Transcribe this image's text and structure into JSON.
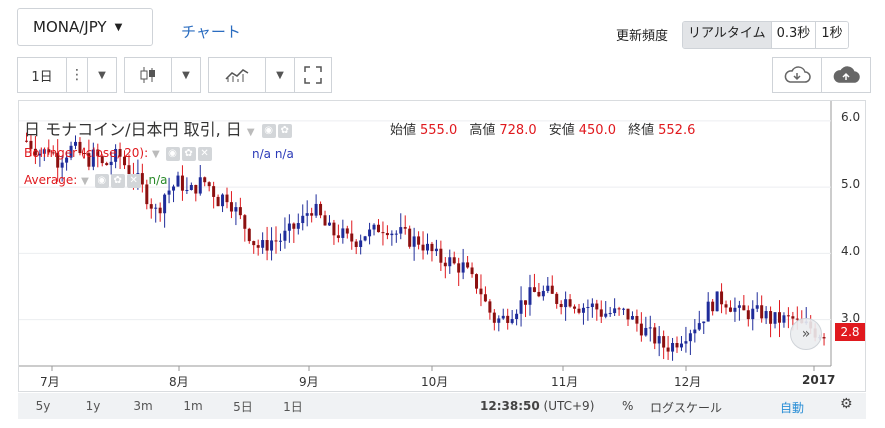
{
  "header": {
    "pair": "MONA/JPY",
    "chart_link": "チャート",
    "freq_label": "更新頻度",
    "freq_options": [
      "リアルタイム",
      "0.3秒",
      "1秒"
    ]
  },
  "toolbar": {
    "interval": "1日"
  },
  "legend": {
    "title": "日 モナコイン/日本円 取引, 日",
    "open_label": "始値",
    "open": "555.0",
    "high_label": "高値",
    "high": "728.0",
    "low_label": "安値",
    "low": "450.0",
    "close_label": "終値",
    "close": "552.6",
    "indicator1": "Bollinger (close, 20):",
    "indicator1_values": "n/a n/a",
    "indicator2": "Average:",
    "indicator2_value": "n/a"
  },
  "price_tag": "2.8",
  "chart_data": {
    "type": "candlestick",
    "y_ticks": [
      "6.0",
      "5.0",
      "4.0",
      "3.0"
    ],
    "x_ticks": [
      "7月",
      "8月",
      "9月",
      "10月",
      "11月",
      "12月",
      "2017"
    ],
    "ylim": [
      2.3,
      6.3
    ],
    "close_series": [
      5.7,
      5.6,
      5.5,
      5.6,
      5.4,
      5.5,
      5.6,
      5.5,
      5.4,
      5.5,
      5.3,
      5.4,
      5.5,
      5.3,
      5.2,
      5.0,
      4.8,
      4.6,
      4.9,
      5.0,
      5.1,
      4.9,
      5.0,
      5.1,
      5.0,
      4.8,
      4.9,
      4.7,
      4.5,
      4.3,
      4.1,
      4.1,
      4.2,
      4.2,
      4.3,
      4.4,
      4.5,
      4.7,
      4.6,
      4.4,
      4.3,
      4.3,
      4.2,
      4.2,
      4.3,
      4.3,
      4.4,
      4.4,
      4.3,
      4.3,
      4.2,
      4.2,
      4.1,
      4.0,
      3.9,
      3.9,
      3.8,
      3.8,
      3.6,
      3.5,
      3.2,
      3.0,
      3.0,
      3.1,
      3.2,
      3.3,
      3.4,
      3.4,
      3.4,
      3.3,
      3.3,
      3.3,
      3.2,
      3.2,
      3.2,
      3.1,
      3.1,
      3.1,
      3.1,
      3.0,
      2.9,
      2.8,
      2.7,
      2.6,
      2.6,
      2.7,
      2.8,
      2.9,
      3.0,
      3.2,
      3.3,
      3.3,
      3.2,
      3.1,
      3.1,
      3.1,
      3.1,
      3.0,
      3.0,
      3.0,
      3.0,
      2.9,
      2.9,
      2.8,
      2.8
    ]
  },
  "bottom": {
    "ranges": [
      "5y",
      "1y",
      "3m",
      "1m",
      "5日",
      "1日"
    ],
    "time": "12:38:50",
    "tz": "(UTC+9)",
    "percent": "%",
    "log": "ログスケール",
    "auto": "自動"
  },
  "colors": {
    "up": "#1f2c9a",
    "down": "#e0191e",
    "candle_down_body": "#8b1010"
  }
}
